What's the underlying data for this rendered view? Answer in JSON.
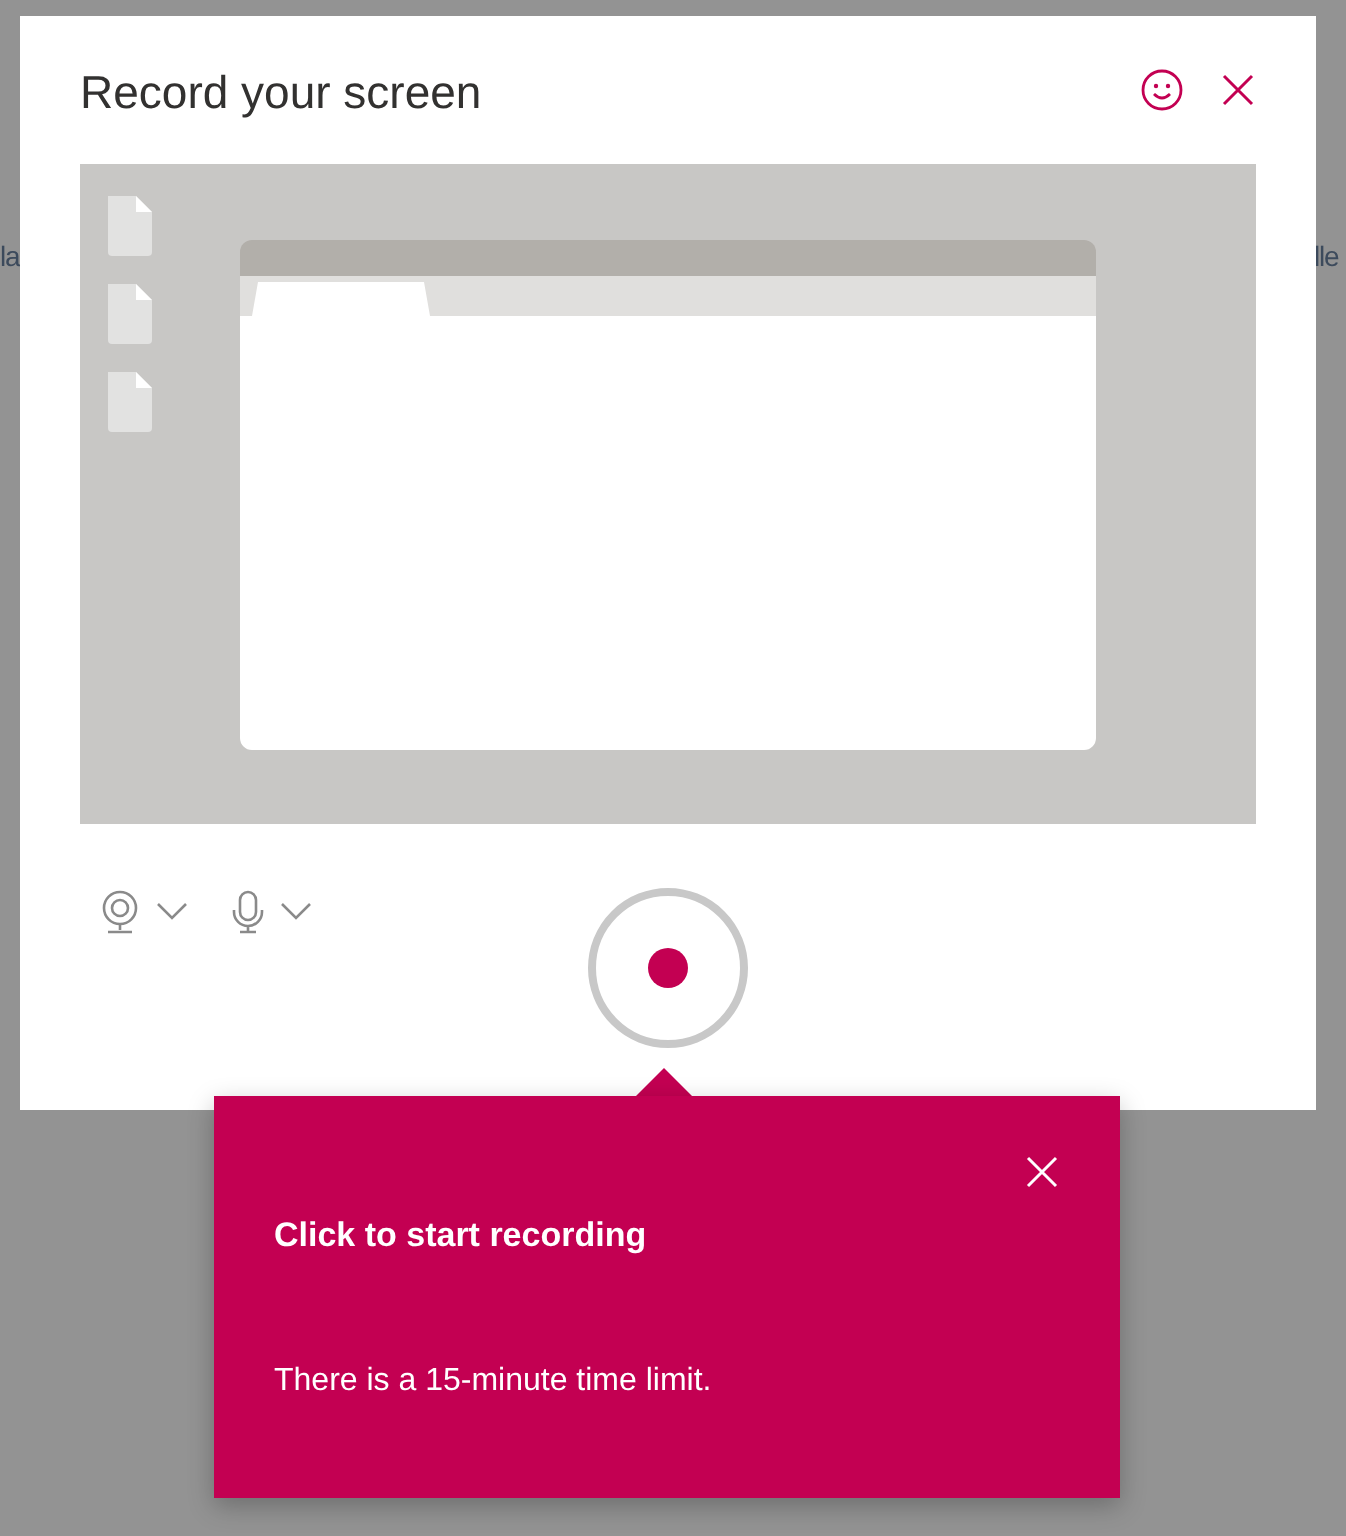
{
  "background_texts": [
    {
      "text": "la"
    },
    {
      "text": "lle"
    }
  ],
  "dialog": {
    "title": "Record your screen"
  },
  "callout": {
    "title": "Click to start recording",
    "text": "There is a 15-minute time limit."
  }
}
